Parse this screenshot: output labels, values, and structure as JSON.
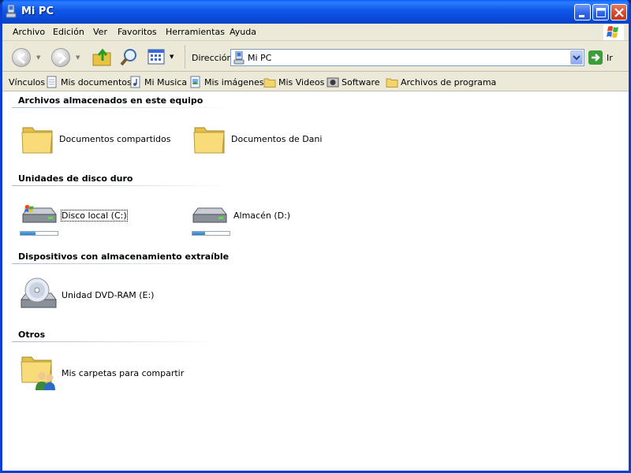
{
  "window": {
    "title": "Mi PC"
  },
  "menu": [
    "Archivo",
    "Edición",
    "Ver",
    "Favoritos",
    "Herramientas",
    "Ayuda"
  ],
  "address": {
    "label": "Dirección",
    "value": "Mi PC",
    "go_label": "Ir"
  },
  "links": {
    "label": "Vínculos",
    "items": [
      "Mis documentos",
      "Mi Musica",
      "Mis imágenes",
      "Mis Videos",
      "Software",
      "Archivos de programa"
    ]
  },
  "groups": {
    "stored": {
      "title": "Archivos almacenados en este equipo",
      "items": [
        "Documentos compartidos",
        "Documentos de Dani"
      ]
    },
    "hdd": {
      "title": "Unidades de disco duro",
      "items": [
        {
          "label": "Disco local (C:)",
          "usage": 0.4
        },
        {
          "label": "Almacén (D:)",
          "usage": 0.35
        }
      ]
    },
    "removable": {
      "title": "Dispositivos con almacenamiento extraíble",
      "items": [
        "Unidad DVD-RAM (E:)"
      ]
    },
    "others": {
      "title": "Otros",
      "items": [
        "Mis carpetas para compartir"
      ]
    }
  },
  "colors": {
    "title_bar": "#0f56e8",
    "group_line": "#a7bad3",
    "folder": "#f4d46b"
  }
}
